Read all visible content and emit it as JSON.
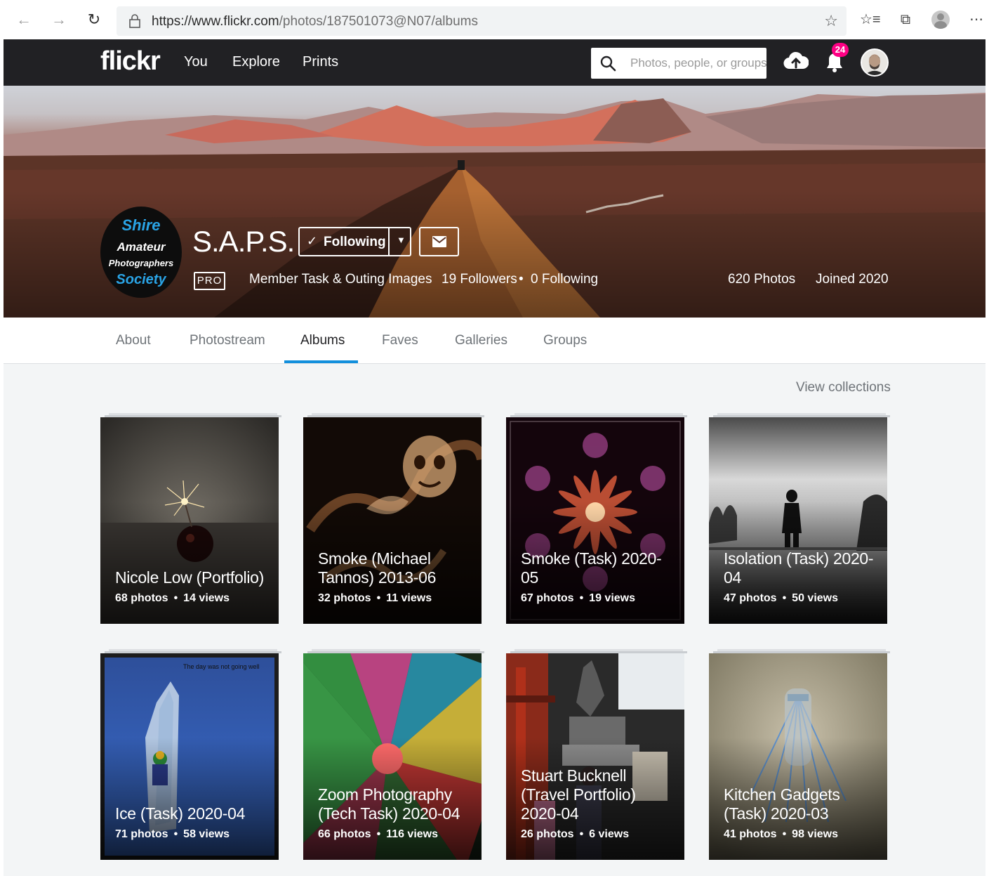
{
  "browser": {
    "url_host": "https://www.flickr.com",
    "url_path": "/photos/187501073@N07/albums"
  },
  "header": {
    "logo": "flickr",
    "nav": [
      "You",
      "Explore",
      "Prints"
    ],
    "search_placeholder": "Photos, people, or groups",
    "notifications": "24"
  },
  "profile": {
    "avatar_lines": [
      "Shire",
      "Amateur",
      "Photographers",
      "Society"
    ],
    "name": "S.A.P.S.",
    "follow_label": "Following",
    "pro_label": "PRO",
    "description": "Member Task & Outing Images",
    "followers": "19 Followers",
    "separator": "•",
    "following": "0 Following",
    "photos": "620 Photos",
    "joined": "Joined 2020"
  },
  "tabs": [
    {
      "label": "About",
      "active": false
    },
    {
      "label": "Photostream",
      "active": false
    },
    {
      "label": "Albums",
      "active": true
    },
    {
      "label": "Faves",
      "active": false
    },
    {
      "label": "Galleries",
      "active": false
    },
    {
      "label": "Groups",
      "active": false
    }
  ],
  "view_collections": "View collections",
  "albums": [
    {
      "title": "Nicole Low (Portfolio)",
      "photos": "68 photos",
      "views": "14 views"
    },
    {
      "title": "Smoke (Michael Tannos) 2013-06",
      "photos": "32 photos",
      "views": "11 views"
    },
    {
      "title": "Smoke (Task) 2020-05",
      "photos": "67 photos",
      "views": "19 views"
    },
    {
      "title": "Isolation (Task) 2020-04",
      "photos": "47 photos",
      "views": "50 views"
    },
    {
      "title": "Ice (Task) 2020-04",
      "photos": "71 photos",
      "views": "58 views",
      "caption": "The day was not going well"
    },
    {
      "title": "Zoom Photography (Tech Task) 2020-04",
      "photos": "66 photos",
      "views": "116 views"
    },
    {
      "title": "Stuart Bucknell (Travel Portfolio) 2020-04",
      "photos": "26 photos",
      "views": "6 views"
    },
    {
      "title": "Kitchen Gadgets (Task) 2020-03",
      "photos": "41 photos",
      "views": "98 views"
    }
  ],
  "colors": {
    "header_bg": "#212124",
    "accent_blue": "#128fdc",
    "badge_pink": "#ff0084",
    "content_bg": "#f3f5f6"
  },
  "icons": [
    "back-icon",
    "forward-icon",
    "refresh-icon",
    "lock-icon",
    "star-icon",
    "favorites-icon",
    "collections-icon",
    "profile-icon",
    "more-icon",
    "search-icon",
    "upload-icon",
    "bell-icon",
    "check-icon",
    "caret-down-icon",
    "mail-icon"
  ]
}
